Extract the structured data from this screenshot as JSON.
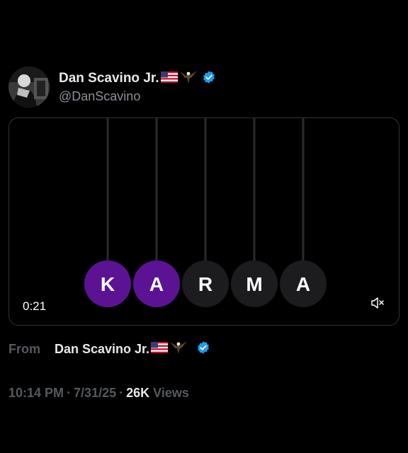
{
  "post": {
    "author": {
      "display_name": "Dan Scavino Jr.",
      "handle": "@DanScavino",
      "badges": [
        "us-flag-icon",
        "eagle-icon",
        "verified-icon"
      ],
      "verified_color": "#1d9bf0"
    },
    "media": {
      "duration": "0:21",
      "balls": [
        {
          "letter": "K",
          "active": true
        },
        {
          "letter": "A",
          "active": true
        },
        {
          "letter": "R",
          "active": false
        },
        {
          "letter": "M",
          "active": false
        },
        {
          "letter": "A",
          "active": false
        }
      ],
      "active_color": "#5b1394",
      "inactive_color": "#1c1c1e",
      "mute_icon": "speaker-muted-icon"
    },
    "from": {
      "label": "From",
      "name": "Dan Scavino Jr."
    },
    "meta": {
      "time": "10:14 PM",
      "date": "7/31/25",
      "views_count": "26K",
      "views_label": "Views"
    }
  }
}
